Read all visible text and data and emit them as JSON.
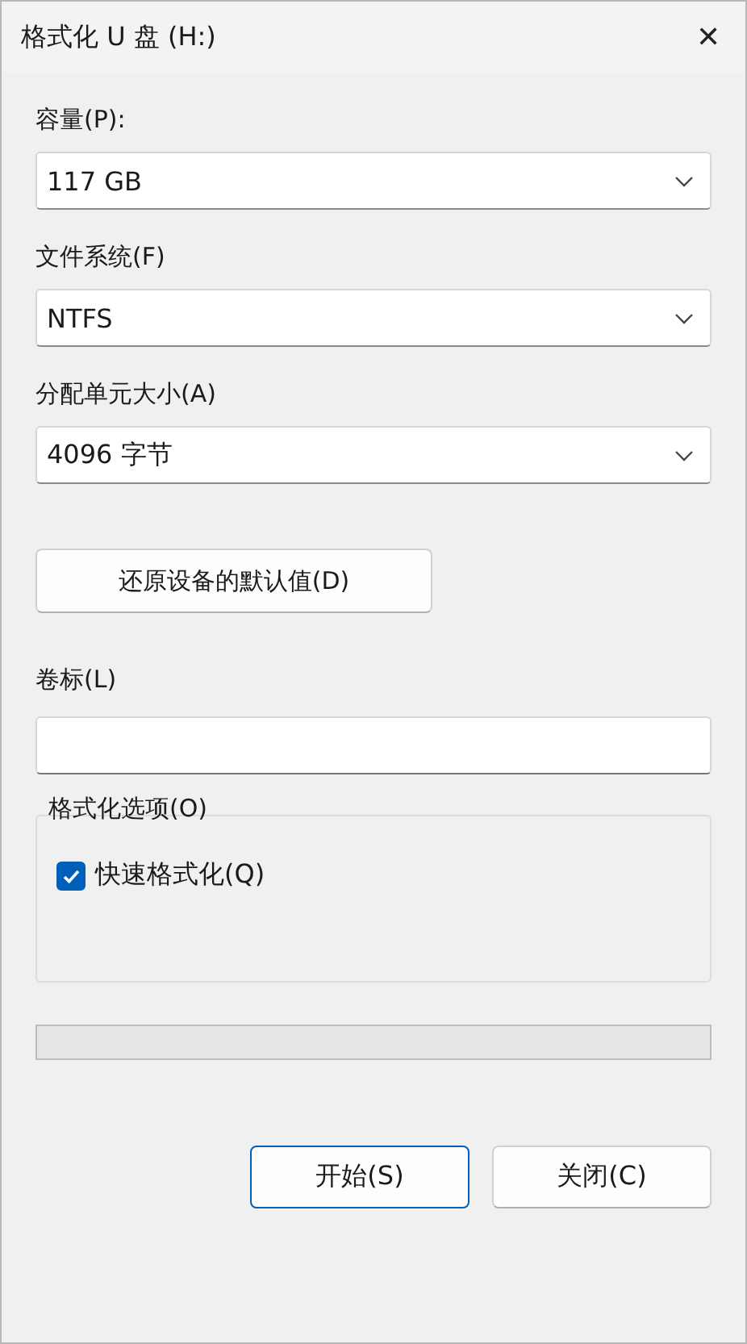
{
  "window": {
    "title": "格式化 U 盘 (H:)",
    "close": "✕"
  },
  "fields": [
    {
      "label": "容量(P):",
      "value": "117 GB"
    },
    {
      "label": "文件系统(F)",
      "value": "NTFS"
    },
    {
      "label": "分配单元大小(A)",
      "value": "4096 字节"
    }
  ],
  "restore_button": "还原设备的默认值(D)",
  "volume_label": {
    "label": "卷标(L)"
  },
  "options": {
    "title": "格式化选项(O)",
    "items": [
      {
        "label": "快速格式化(Q)",
        "checked": true
      }
    ]
  },
  "progress": {
    "level": 0
  },
  "buttons": [
    {
      "label": "开始(S)",
      "selected": true
    },
    {
      "label": "关闭(C)",
      "selected": false
    }
  ]
}
